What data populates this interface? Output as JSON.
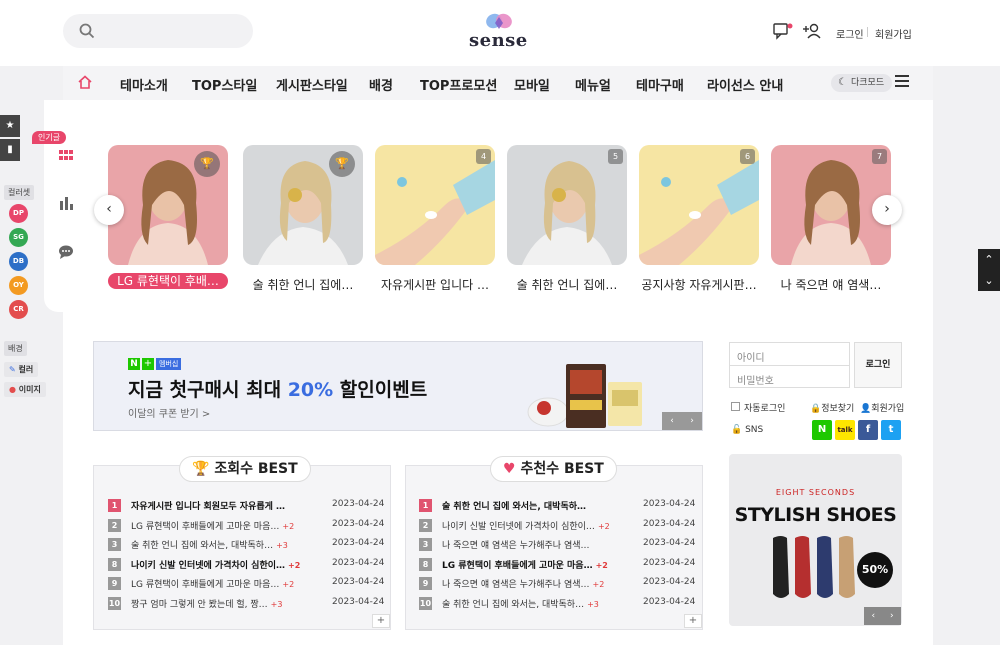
{
  "header": {
    "logo_text": "sense",
    "login_label": "로그인",
    "signup_label": "회원가입"
  },
  "nav": {
    "items": [
      "테마소개",
      "TOP스타일",
      "게시판스타일",
      "배경",
      "TOP프로모션",
      "모바일",
      "메뉴얼",
      "테마구매",
      "라이선스 안내"
    ],
    "dark_mode": "다크모드"
  },
  "sidebar": {
    "popular_badge": "인기글",
    "color_set_label": "컬러셋",
    "colors": [
      {
        "code": "DP",
        "color": "#e8466a"
      },
      {
        "code": "SG",
        "color": "#34a853"
      },
      {
        "code": "DB",
        "color": "#2d6fc7"
      },
      {
        "code": "OY",
        "color": "#f39a21"
      },
      {
        "code": "CR",
        "color": "#e34d4d"
      }
    ],
    "background_label": "배경",
    "bg_color": "컬러",
    "bg_image": "이미지"
  },
  "carousel": {
    "items": [
      {
        "title": "LG 류현택이 후배…",
        "badge": "trophy"
      },
      {
        "title": "술 취한 언니 집에…",
        "badge": "trophy"
      },
      {
        "title": "자유게시판 입니다 …",
        "badge": "4"
      },
      {
        "title": "술 취한 언니 집에…",
        "badge": "5"
      },
      {
        "title": "공지사항 자유게시판…",
        "badge": "6"
      },
      {
        "title": "나 죽으면 얘 염색…",
        "badge": "7"
      }
    ]
  },
  "banner": {
    "tag_n": "N",
    "tag_plus": "+",
    "tag_member": "멤버십",
    "title_pre": "지금 첫구매시 최대 ",
    "title_pct": "20%",
    "title_post": " 할인이벤트",
    "subtitle": "이달의 쿠폰 받기 >"
  },
  "login": {
    "id_placeholder": "아이디",
    "pw_placeholder": "비밀번호",
    "button": "로그인",
    "auto_login": "자동로그인",
    "find_info": "정보찾기",
    "signup": "회원가입",
    "sns": "SNS"
  },
  "ad": {
    "top_text": "EIGHT SECONDS",
    "title": "STYLISH SHOES",
    "discount": "50%"
  },
  "best_views": {
    "title": "조회수 BEST",
    "rows": [
      {
        "rank": "1",
        "title": "자유게시판 입니다 회원모두 자유롭게 …",
        "comments": "",
        "date": "2023-04-24",
        "bold": true,
        "red": true
      },
      {
        "rank": "2",
        "title": "LG 류현택이 후배들에게 고마운 마음…",
        "comments": "+2",
        "date": "2023-04-24",
        "bold": false,
        "red": false
      },
      {
        "rank": "3",
        "title": "술 취한 언니 집에 와서는, 대박독하…",
        "comments": "+3",
        "date": "2023-04-24",
        "bold": false,
        "red": false
      },
      {
        "rank": "8",
        "title": "나이키 신발 인터넷에 가격차이 심한이…",
        "comments": "+2",
        "date": "2023-04-24",
        "bold": true,
        "red": false
      },
      {
        "rank": "9",
        "title": "LG 류현택이 후배들에게 고마운 마음…",
        "comments": "+2",
        "date": "2023-04-24",
        "bold": false,
        "red": false
      },
      {
        "rank": "10",
        "title": "짱구 엄마 그렇게 안 봤는데 헐, 짱…",
        "comments": "+3",
        "date": "2023-04-24",
        "bold": false,
        "red": false
      }
    ]
  },
  "best_recommend": {
    "title": "추천수 BEST",
    "rows": [
      {
        "rank": "1",
        "title": "술 취한 언니 집에 와서는, 대박독하…",
        "comments": "",
        "date": "2023-04-24",
        "bold": true,
        "red": true
      },
      {
        "rank": "2",
        "title": "나이키 신발 인터넷에 가격차이 심한이…",
        "comments": "+2",
        "date": "2023-04-24",
        "bold": false,
        "red": false
      },
      {
        "rank": "3",
        "title": "나 죽으면 얘 염색은 누가해주나 염색…",
        "comments": "",
        "date": "2023-04-24",
        "bold": false,
        "red": false
      },
      {
        "rank": "8",
        "title": "LG 류현택이 후배들에게 고마운 마음…",
        "comments": "+2",
        "date": "2023-04-24",
        "bold": true,
        "red": false
      },
      {
        "rank": "9",
        "title": "나 죽으면 얘 염색은 누가해주나 염색…",
        "comments": "+2",
        "date": "2023-04-24",
        "bold": false,
        "red": false
      },
      {
        "rank": "10",
        "title": "술 취한 언니 집에 와서는, 대박독하…",
        "comments": "+3",
        "date": "2023-04-24",
        "bold": false,
        "red": false
      }
    ]
  }
}
